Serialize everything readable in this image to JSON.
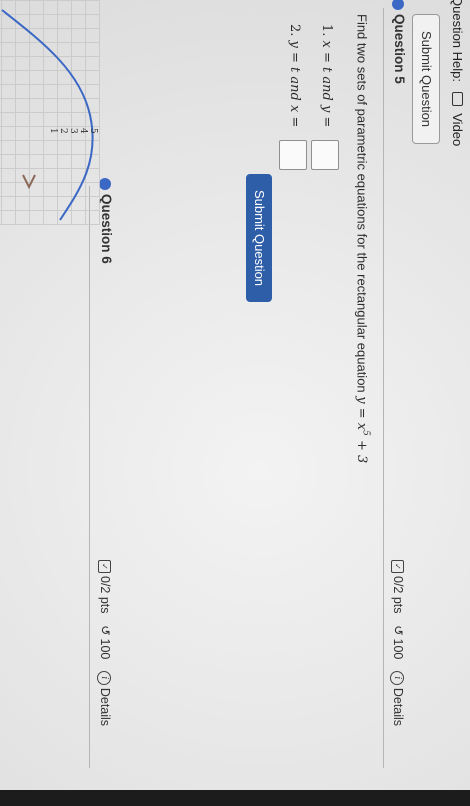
{
  "header": {
    "question_help": "Question Help:",
    "video_label": "Video"
  },
  "buttons": {
    "submit_top": "Submit Question",
    "submit_question": "Submit Question"
  },
  "question5": {
    "title": "Question 5",
    "score": "0/2 pts",
    "attempts": "100",
    "details": "Details",
    "prompt": "Find two sets of parametric equations for the rectangular equation",
    "equation_lhs": "y = x",
    "equation_exp": "5",
    "equation_rhs": " + 3",
    "part1_num": "1.",
    "part1_text": "x = t and y =",
    "part2_num": "2.",
    "part2_text": "y = t and x ="
  },
  "question6": {
    "title": "Question 6",
    "score": "0/2 pts",
    "attempts": "100",
    "details": "Details"
  },
  "graph": {
    "tick_labels": [
      "5",
      "4",
      "3",
      "2",
      "1"
    ]
  },
  "colors": {
    "accent": "#2f5ea8",
    "dot": "#3b68c4"
  }
}
